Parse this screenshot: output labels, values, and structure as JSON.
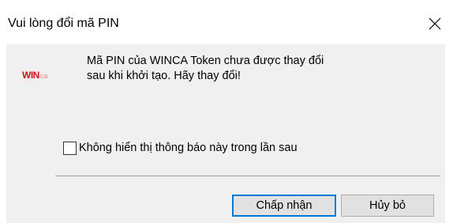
{
  "window": {
    "title": "Vui lòng đổi mã PIN",
    "close_icon": "close-icon"
  },
  "logo": {
    "brand_main": "WIN",
    "brand_suffix": "ca",
    "brand_color": "#d0121b"
  },
  "message": {
    "line1": "Mã PIN của WINCA Token chưa được thay đổi",
    "line2": "sau khi khởi tạo. Hãy thay đổi!"
  },
  "checkbox": {
    "label": "Không hiển thị thông báo này trong lần sau",
    "checked": false
  },
  "buttons": {
    "ok_label": "Chấp nhận",
    "cancel_label": "Hủy bỏ"
  },
  "colors": {
    "accent": "#0078d7",
    "panel_background": "#f0f0f0"
  }
}
